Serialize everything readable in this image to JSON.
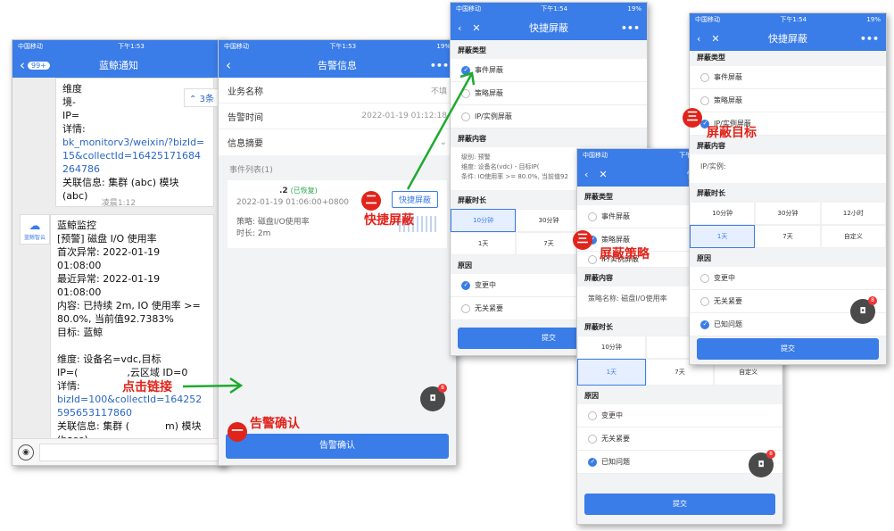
{
  "p1": {
    "carrier": "中国移动",
    "time": "下午1:53",
    "badge": "99+",
    "title": "蓝鲸通知",
    "msg1": [
      "维度",
      "境-",
      "IP=",
      "详情:"
    ],
    "msg1_link": "bk_monitorv3/weixin/?bizId=15&collectId=16425171684264786",
    "msg1_assoc": "关联信息: 集群 (abc) 模块 (abc)",
    "toast": "3条",
    "timestamp": "凌晨1:12",
    "avatar_label": "蓝鲸智云",
    "msg2": [
      "蓝鲸监控",
      "[预警] 磁盘 I/O 使用率",
      "首次异常: 2022-01-19 01:08:00",
      "最近异常: 2022-01-19 01:08:00",
      "内容: 已持续 2m, IO 使用率 >= 80.0%, 当前值92.7383%",
      "目标: 蓝鲸",
      "",
      "维度: 设备名=vdc,目标",
      "IP=(",
      ",云区域 ID=0"
    ],
    "msg2_detail": "详情:",
    "msg2_link": "bizId=100&collectId=164252595653117860",
    "msg2_assoc": "关联信息: 集群 (",
    "msg2_assoc2": "m) 模块 (base)"
  },
  "p2": {
    "carrier": "中国移动",
    "time": "下午1:53",
    "battery": "19%",
    "title": "告警信息",
    "biz_label": "业务名称",
    "biz_value": "不填",
    "time_label": "告警时间",
    "time_value": "2022-01-19 01:12:18",
    "summary_label": "信息摘要",
    "events_label": "事件列表(1)",
    "event_title": ".2",
    "event_status": "(已恢复)",
    "event_time": "2022-01-19 01:06:00+0800",
    "event_strategy": "策略: 磁盘I/O使用率",
    "event_duration": "时长: 2m",
    "quick_btn": "快捷屏蔽",
    "confirm_btn": "告警确认",
    "fab_badge": "8"
  },
  "p3": {
    "carrier": "中国移动",
    "time": "下午1:54",
    "battery": "19%",
    "title": "快捷屏蔽",
    "type_label": "屏蔽类型",
    "types": [
      "事件屏蔽",
      "策略屏蔽",
      "IP/实例屏蔽"
    ],
    "content_label": "屏蔽内容",
    "content": [
      "级别: 预警",
      "维度: 设备名(vdc) - 目标IP(",
      "条件: IO使用率 >= 80.0%, 当前值92"
    ],
    "dur_label": "屏蔽时长",
    "durs": [
      "10分钟",
      "30分钟",
      "",
      "1天",
      "7天",
      ""
    ],
    "reason_label": "原因",
    "reasons": [
      "变更中",
      "无关紧要"
    ],
    "submit": "提交"
  },
  "p4": {
    "carrier": "中国移动",
    "time": "下午1:54",
    "battery": "",
    "title": "快捷屏蔽",
    "type_label": "屏蔽类型",
    "types": [
      "事件屏蔽",
      "策略屏蔽",
      "IP/实例屏蔽"
    ],
    "content_label": "屏蔽内容",
    "content": "策略名称: 磁盘I/O使用率",
    "dur_label": "屏蔽时长",
    "durs": [
      "10分钟",
      "",
      "",
      "1天",
      "7天",
      "自定义"
    ],
    "reason_label": "原因",
    "reasons": [
      "变更中",
      "无关紧要",
      "已知问题"
    ],
    "submit": "提交",
    "fab_badge": "8"
  },
  "p5": {
    "carrier": "中国移动",
    "time": "下午1:54",
    "battery": "19%",
    "title": "快捷屏蔽",
    "type_label": "屏蔽类型",
    "types": [
      "事件屏蔽",
      "策略屏蔽",
      "IP/实例屏蔽"
    ],
    "content_label": "屏蔽内容",
    "content": "IP/实例: ",
    "dur_label": "屏蔽时长",
    "durs": [
      "10分钟",
      "30分钟",
      "12小时",
      "1天",
      "7天",
      "自定义"
    ],
    "reason_label": "原因",
    "reasons": [
      "变更中",
      "无关紧要",
      "已知问题"
    ],
    "submit": "提交",
    "fab_badge": "8"
  },
  "ann": {
    "n1": "一",
    "t1": "告警确认",
    "n2": "二",
    "t2": "快捷屏蔽",
    "n3a": "三",
    "t3a": "屏蔽策略",
    "n3b": "三",
    "t3b": "屏蔽目标",
    "click": "点击链接"
  },
  "colors": {
    "accent": "#3a7ce8",
    "annotation": "#e0241b",
    "arrow": "#1faa2e"
  }
}
